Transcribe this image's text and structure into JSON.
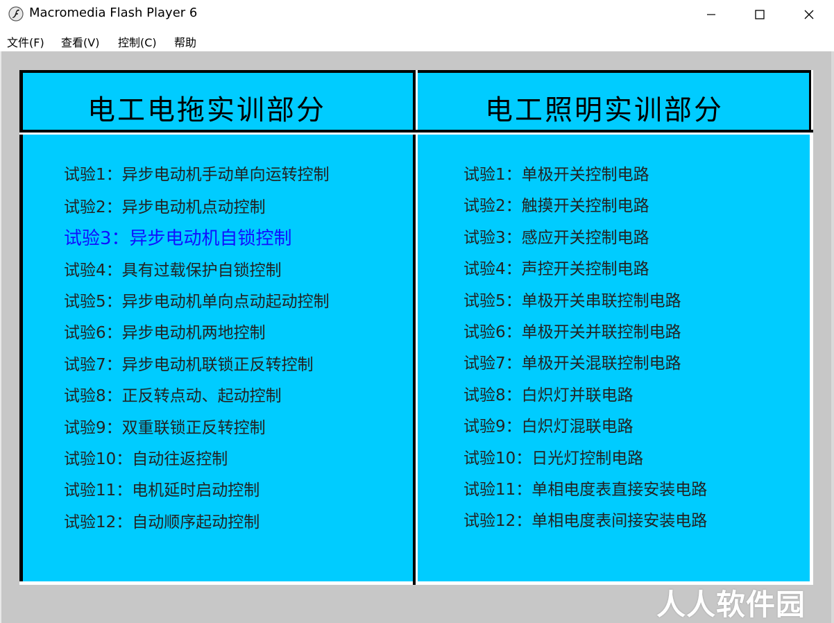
{
  "window": {
    "title": "Macromedia Flash Player 6",
    "controls": {
      "minimize_icon": "minimize-icon",
      "maximize_icon": "maximize-icon",
      "close_icon": "close-icon"
    }
  },
  "menu": {
    "file": "文件(F)",
    "view": "查看(V)",
    "control": "控制(C)",
    "help": "帮助"
  },
  "panel": {
    "accent_color": "#00ccff",
    "highlight_color": "#1010ff",
    "left": {
      "title": "电工电拖实训部分",
      "items": [
        "试验1：异步电动机手动单向运转控制",
        "试验2：异步电动机点动控制",
        "试验3：异步电动机自锁控制",
        "试验4：具有过载保护自锁控制",
        "试验5：异步电动机单向点动起动控制",
        "试验6：异步电动机两地控制",
        "试验7：异步电动机联锁正反转控制",
        "试验8：正反转点动、起动控制",
        "试验9：双重联锁正反转控制",
        "试验10：自动往返控制",
        "试验11：电机延时启动控制",
        "试验12：自动顺序起动控制"
      ],
      "active_index": 2
    },
    "right": {
      "title": "电工照明实训部分",
      "items": [
        "试验1：单极开关控制电路",
        "试验2：触摸开关控制电路",
        "试验3：感应开关控制电路",
        "试验4：声控开关控制电路",
        "试验5：单极开关串联控制电路",
        "试验6：单极开关并联控制电路",
        "试验7：单极开关混联控制电路",
        "试验8：白炽灯并联电路",
        "试验9：白炽灯混联电路",
        "试验10：日光灯控制电路",
        "试验11：单相电度表直接安装电路",
        "试验12：单相电度表间接安装电路"
      ]
    }
  },
  "watermark": {
    "text": "人人软件园"
  }
}
